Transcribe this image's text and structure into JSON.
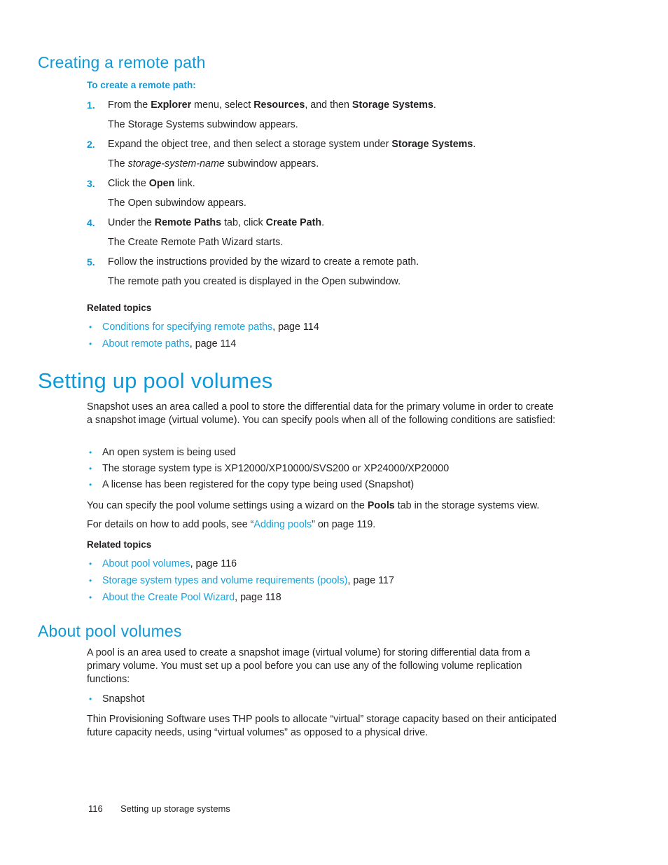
{
  "page": {
    "footer_page_number": "116",
    "footer_chapter": "Setting up storage systems",
    "accent_color": "#0e9ad8",
    "link_color": "#17a3dd",
    "text_color": "#231f20"
  },
  "section_remote_path": {
    "heading": "Creating a remote path",
    "subheading": "To create a remote path:",
    "steps": [
      {
        "number": "1.",
        "text_parts": [
          {
            "t": "From the ",
            "style": "normal"
          },
          {
            "t": "Explorer",
            "style": "bold"
          },
          {
            "t": " menu, select ",
            "style": "normal"
          },
          {
            "t": "Resources",
            "style": "bold"
          },
          {
            "t": ", and then ",
            "style": "normal"
          },
          {
            "t": "Storage Systems",
            "style": "bold"
          },
          {
            "t": ".",
            "style": "normal"
          }
        ],
        "result_parts": [
          {
            "t": "The Storage Systems subwindow appears.",
            "style": "normal"
          }
        ]
      },
      {
        "number": "2.",
        "text_parts": [
          {
            "t": "Expand the object tree, and then select a storage system under ",
            "style": "normal"
          },
          {
            "t": "Storage Systems",
            "style": "bold"
          },
          {
            "t": ".",
            "style": "normal"
          }
        ],
        "result_parts": [
          {
            "t": "The ",
            "style": "normal"
          },
          {
            "t": "storage-system-name",
            "style": "italic"
          },
          {
            "t": " subwindow appears.",
            "style": "normal"
          }
        ]
      },
      {
        "number": "3.",
        "text_parts": [
          {
            "t": "Click the ",
            "style": "normal"
          },
          {
            "t": "Open",
            "style": "bold"
          },
          {
            "t": " link.",
            "style": "normal"
          }
        ],
        "result_parts": [
          {
            "t": "The Open subwindow appears.",
            "style": "normal"
          }
        ]
      },
      {
        "number": "4.",
        "text_parts": [
          {
            "t": "Under the ",
            "style": "normal"
          },
          {
            "t": "Remote Paths",
            "style": "bold"
          },
          {
            "t": " tab, click ",
            "style": "normal"
          },
          {
            "t": "Create Path",
            "style": "bold"
          },
          {
            "t": ".",
            "style": "normal"
          }
        ],
        "result_parts": [
          {
            "t": "The Create Remote Path Wizard starts.",
            "style": "normal"
          }
        ]
      },
      {
        "number": "5.",
        "text_parts": [
          {
            "t": "Follow the instructions provided by the wizard to create a remote path.",
            "style": "normal"
          }
        ],
        "result_parts": [
          {
            "t": "The remote path you created is displayed in the Open subwindow.",
            "style": "normal"
          }
        ]
      }
    ],
    "related_topics_label": "Related topics",
    "related_topics": [
      {
        "bullet": "•",
        "link": "Conditions for specifying remote paths",
        "suffix": ", page 114"
      },
      {
        "bullet": "•",
        "link": "About remote paths",
        "suffix": ", page 114"
      }
    ]
  },
  "section_pool_volumes": {
    "heading": "Setting up pool volumes",
    "intro_parts": [
      {
        "t": "Snapshot uses an area called a pool to store the differential data for the primary volume in order to create a snapshot image (virtual volume). You can specify pools when all of the following conditions are satisfied:",
        "style": "normal"
      }
    ],
    "conditions": [
      {
        "bullet": "•",
        "text": "An open system is being used"
      },
      {
        "bullet": "•",
        "text": "The storage system type is XP12000/XP10000/SVS200 or XP24000/XP20000"
      },
      {
        "bullet": "•",
        "text": "A license has been registered for the copy type being used (Snapshot)"
      }
    ],
    "wizard_note_parts": [
      {
        "t": "You can specify the pool volume settings using a wizard on the ",
        "style": "normal"
      },
      {
        "t": "Pools",
        "style": "bold"
      },
      {
        "t": " tab in the storage systems view.",
        "style": "normal"
      }
    ],
    "details_note_parts": [
      {
        "t": " For details on how to add pools, see “",
        "style": "normal"
      },
      {
        "t": "Adding pools",
        "style": "link"
      },
      {
        "t": "” on page 119.",
        "style": "normal"
      }
    ],
    "related_topics_label": "Related topics",
    "related_topics": [
      {
        "bullet": "•",
        "link": "About pool volumes",
        "suffix": ", page 116"
      },
      {
        "bullet": "•",
        "link": "Storage system types and volume requirements (pools)",
        "suffix": ", page 117"
      },
      {
        "bullet": "•",
        "link": "About the Create Pool Wizard",
        "suffix": ", page 118"
      }
    ]
  },
  "section_about_pool_volumes": {
    "heading": "About pool volumes",
    "intro": "A pool is an area used to create a snapshot image (virtual volume) for storing differential data from a primary volume. You must set up a pool before you can use any of the following volume replication functions:",
    "functions": [
      {
        "bullet": "•",
        "text": "Snapshot"
      }
    ],
    "closing": "Thin Provisioning Software uses THP pools to allocate “virtual” storage capacity based on their anticipated future capacity needs, using “virtual volumes” as opposed to a physical drive."
  }
}
